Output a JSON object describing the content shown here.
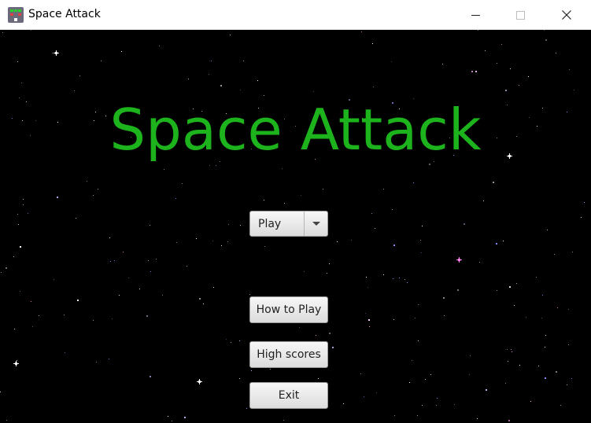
{
  "window": {
    "title": "Space Attack",
    "app_icon": "space-invader-icon",
    "controls": {
      "minimize_icon": "minimize-icon",
      "maximize_icon": "maximize-icon",
      "close_icon": "close-icon"
    }
  },
  "game": {
    "title": "Space Attack",
    "title_color": "#1db31d",
    "background_color": "#000000",
    "mode_select": {
      "selected": "Play",
      "arrow_icon": "chevron-down-icon"
    },
    "buttons": {
      "how_to_play": "How to Play",
      "high_scores": "High scores",
      "exit": "Exit"
    }
  }
}
